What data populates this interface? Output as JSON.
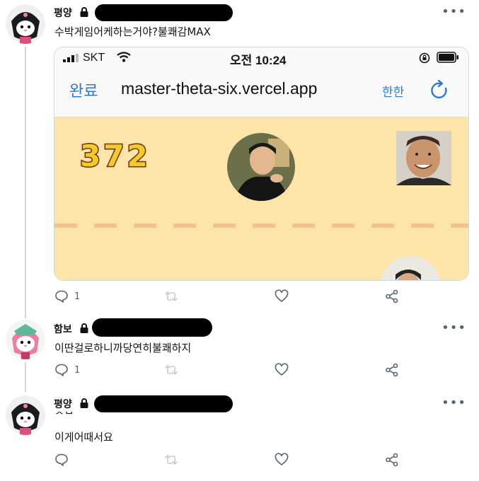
{
  "tweets": [
    {
      "author": "평양",
      "text": "수박게임어케하는거야?불쾌감MAX",
      "reply_count": "1"
    },
    {
      "author": "함보",
      "text": "이딴걸로하니까당연히불쾌하지",
      "reply_count": "1"
    },
    {
      "author": "평양",
      "partial_line": "ㅅㅂ",
      "text": "이게어때서요",
      "reply_count": ""
    }
  ],
  "more_label": "•••",
  "embed": {
    "carrier": "SKT",
    "time": "오전 10:24",
    "done_label": "완료",
    "url": "master-theta-six.vercel.app",
    "translate_label": "한한",
    "score": "372"
  },
  "colors": {
    "game_background": "#fde4a8",
    "score_fill": "#f2cb2a",
    "score_outline": "#6b3410",
    "link_blue": "#2a7ad6",
    "muted_gray": "#536471"
  }
}
